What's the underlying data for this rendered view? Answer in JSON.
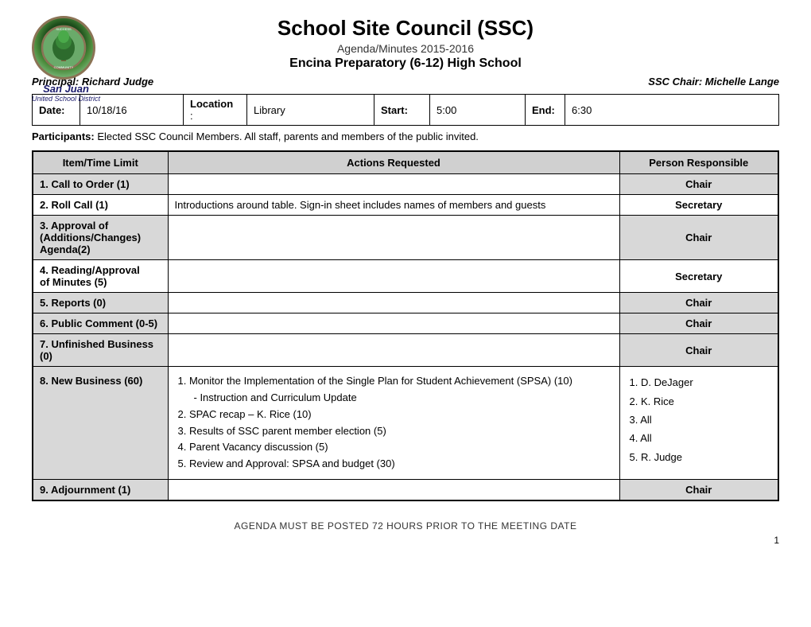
{
  "header": {
    "title": "School Site Council (SSC)",
    "subtitle": "Agenda/Minutes 2015-2016",
    "school": "Encina Preparatory (6-12) High School",
    "principal": "Principal: Richard Judge",
    "ssc_chair": "SSC Chair: Michelle Lange",
    "logo_san_juan": "San Juan",
    "logo_usd": "United School District"
  },
  "info_row": {
    "date_label": "Date:",
    "date_value": "10/18/16",
    "location_label": "Location",
    "location_colon": ":",
    "location_value": "Library",
    "start_label": "Start:",
    "start_value": "5:00",
    "end_label": "End:",
    "end_value": "6:30"
  },
  "participants": {
    "label": "Participants:",
    "text": "Elected SSC Council Members.  All staff, parents and members of the public invited."
  },
  "table": {
    "col_item": "Item/Time Limit",
    "col_actions": "Actions Requested",
    "col_person": "Person Responsible",
    "rows": [
      {
        "item": "1. Call to Order  (1)",
        "actions": "",
        "person": "Chair"
      },
      {
        "item": "2.  Roll Call (1)",
        "actions": "Introductions around table. Sign-in sheet includes names of members and guests",
        "person": "Secretary"
      },
      {
        "item": "3. Approval of (Additions/Changes) Agenda(2)",
        "actions": "",
        "person": "Chair"
      },
      {
        "item": "4. Reading/Approval of Minutes (5)",
        "actions": "",
        "person": "Secretary"
      },
      {
        "item": "5.  Reports (0)",
        "actions": "",
        "person": "Chair"
      },
      {
        "item": "6.  Public Comment (0-5)",
        "actions": "",
        "person": "Chair"
      },
      {
        "item": "7.  Unfinished Business (0)",
        "actions": "",
        "person": "Chair"
      },
      {
        "item": "8. New Business (60)",
        "actions_list": [
          "1.  Monitor the Implementation of the Single Plan for Student Achievement (SPSA) (10)",
          "     - Instruction and Curriculum Update",
          "2.  SPAC recap – K. Rice (10)",
          "3.  Results of SSC parent member election (5)",
          "4.  Parent Vacancy discussion (5)",
          "5.  Review and Approval: SPSA and budget (30)"
        ],
        "person_list": [
          "1.   D. DeJager",
          "2.   K. Rice",
          "3.   All",
          "4.   All",
          "5.   R. Judge"
        ]
      },
      {
        "item": "9.  Adjournment (1)",
        "actions": "",
        "person": "Chair"
      }
    ]
  },
  "footer": {
    "note": "AGENDA MUST BE POSTED 72 HOURS PRIOR TO THE MEETING DATE",
    "page": "1"
  }
}
